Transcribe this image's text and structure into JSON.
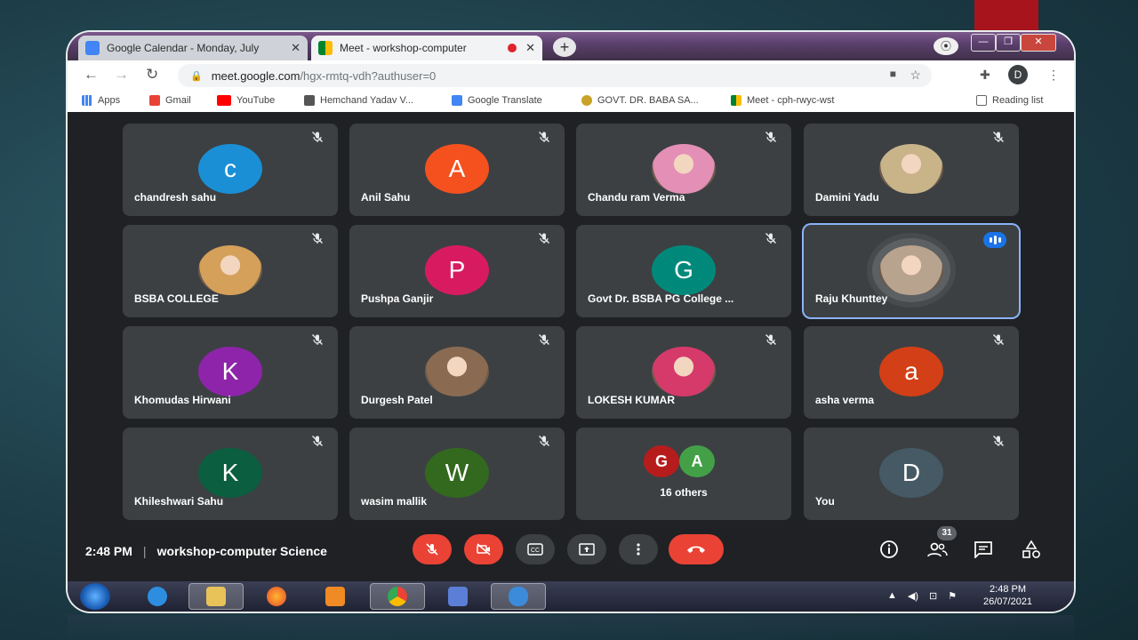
{
  "browser": {
    "tabs": [
      {
        "title": "Google Calendar - Monday, July",
        "icon": "calendar-icon"
      },
      {
        "title": "Meet - workshop-computer",
        "icon": "meet-icon",
        "recording": true
      }
    ],
    "url_host": "meet.google.com",
    "url_path": "/hgx-rmtq-vdh?authuser=0",
    "profile_initial": "D",
    "bookmarks": [
      {
        "label": "Apps",
        "icon": "apps-grid-icon"
      },
      {
        "label": "Gmail",
        "icon": "gmail-icon"
      },
      {
        "label": "YouTube",
        "icon": "youtube-icon"
      },
      {
        "label": "Hemchand Yadav V...",
        "icon": "bookmark-site-icon"
      },
      {
        "label": "Google Translate",
        "icon": "translate-icon"
      },
      {
        "label": "GOVT. DR. BABA SA...",
        "icon": "bookmark-site-icon"
      },
      {
        "label": "Meet - cph-rwyc-wst",
        "icon": "meet-icon"
      }
    ],
    "reading_list": "Reading list"
  },
  "participants": [
    {
      "name": "chandresh sahu",
      "initial": "c",
      "color": "#1a8fd6",
      "muted": true
    },
    {
      "name": "Anil Sahu",
      "initial": "A",
      "color": "#f4511e",
      "muted": true
    },
    {
      "name": "Chandu ram Verma",
      "initial": "",
      "color": "#e38fb6",
      "photo": true,
      "muted": true
    },
    {
      "name": "Damini Yadu",
      "initial": "",
      "color": "#c9b48a",
      "photo": true,
      "muted": true
    },
    {
      "name": "BSBA COLLEGE",
      "initial": "",
      "color": "#d4a05a",
      "photo": true,
      "muted": true
    },
    {
      "name": "Pushpa Ganjir",
      "initial": "P",
      "color": "#d81b60",
      "muted": true
    },
    {
      "name": "Govt Dr. BSBA PG College ...",
      "initial": "G",
      "color": "#00897b",
      "muted": true
    },
    {
      "name": "Raju Khunttey",
      "initial": "",
      "color": "#b8a48e",
      "photo": true,
      "speaking": true
    },
    {
      "name": "Khomudas Hirwani",
      "initial": "K",
      "color": "#8e24aa",
      "muted": true
    },
    {
      "name": "Durgesh Patel",
      "initial": "",
      "color": "#8a6b52",
      "photo": true,
      "muted": true
    },
    {
      "name": "LOKESH KUMAR",
      "initial": "",
      "color": "#d63a6a",
      "photo": true,
      "muted": true
    },
    {
      "name": "asha verma",
      "initial": "a",
      "color": "#d33f16",
      "muted": true
    },
    {
      "name": "Khileshwari Sahu",
      "initial": "K",
      "color": "#0b5e3f",
      "muted": true
    },
    {
      "name": "wasim mallik",
      "initial": "W",
      "color": "#33691e",
      "muted": true
    },
    {
      "name": "16 others",
      "initial": "",
      "color": "#3c4043",
      "group": true
    },
    {
      "name": "You",
      "initial": "D",
      "color": "#455a64",
      "muted": true
    }
  ],
  "others_avatars": [
    {
      "initial": "G",
      "color": "#b71c1c"
    },
    {
      "initial": "A",
      "color": "#43a047"
    }
  ],
  "meeting": {
    "time": "2:48 PM",
    "title": "workshop-computer Science",
    "participant_count": "31"
  },
  "taskbar": {
    "time": "2:48 PM",
    "date": "26/07/2021"
  }
}
